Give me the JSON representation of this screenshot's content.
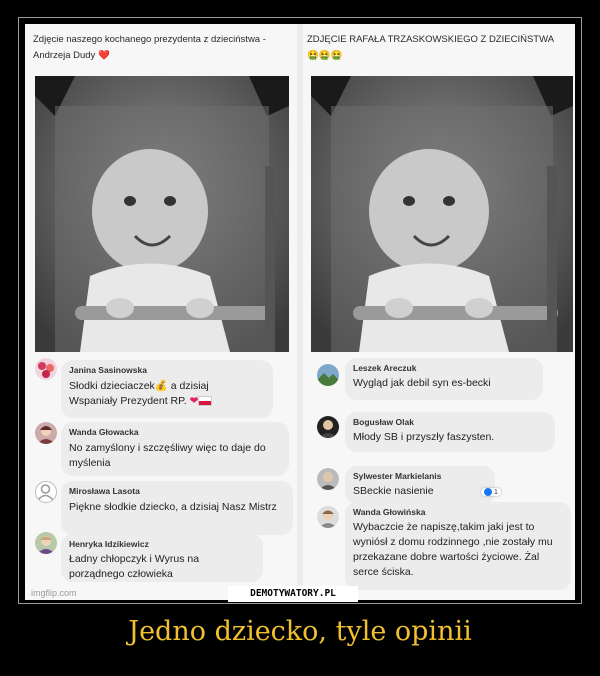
{
  "left": {
    "caption": "Zdjęcie naszego kochanego prezydenta z dzieciństwa - Andrzeja Dudy",
    "caption_emoji": "❤️",
    "comments": [
      {
        "author": "Janina Sasinowska",
        "text": "Słodki dzieciaczek",
        "text2": " a dzisiaj",
        "text3": "Wspaniały Prezydent RP."
      },
      {
        "author": "Wanda Głowacka",
        "text": "No zamyślony  i szczęśliwy  więc  to daje do myślenia"
      },
      {
        "author": "Mirosława Lasota",
        "text": "Piękne słodkie dziecko, a dzisiaj Nasz Mistrz"
      },
      {
        "author": "Henryka Idzikiewicz",
        "text": "Ładny chłopczyk i Wyrus na porządnego człowieka"
      }
    ],
    "watermark": "imgflip.com"
  },
  "right": {
    "caption": "ZDJĘCIE RAFAŁA TRZASKOWSKIEGO Z DZIECIŃSTWA",
    "caption_emoji": "🤮🤮🤮",
    "comments": [
      {
        "author": "Leszek Areczuk",
        "text": "Wygląd jak debil syn es-becki"
      },
      {
        "author": "Bogusław Olak",
        "text": "Młody SB i przyszły faszysten."
      },
      {
        "author": "Sylwester Markielanis",
        "text": "SBeckie nasienie",
        "badge": "1"
      },
      {
        "author": "Wanda Głowińska",
        "text": "Wybaczcie że napiszę,takim jaki jest to wyniósł  z domu rodzinnego ,nie zostały mu przekazane dobre wartości życiowe.  Żal serce ściska."
      }
    ]
  },
  "site_tag": "DEMOTYWATORY.PL",
  "headline": "Jedno dziecko, tyle opinii",
  "colors": {
    "headline": "#f0c02f",
    "background": "#000000",
    "bubble": "#ececec"
  }
}
